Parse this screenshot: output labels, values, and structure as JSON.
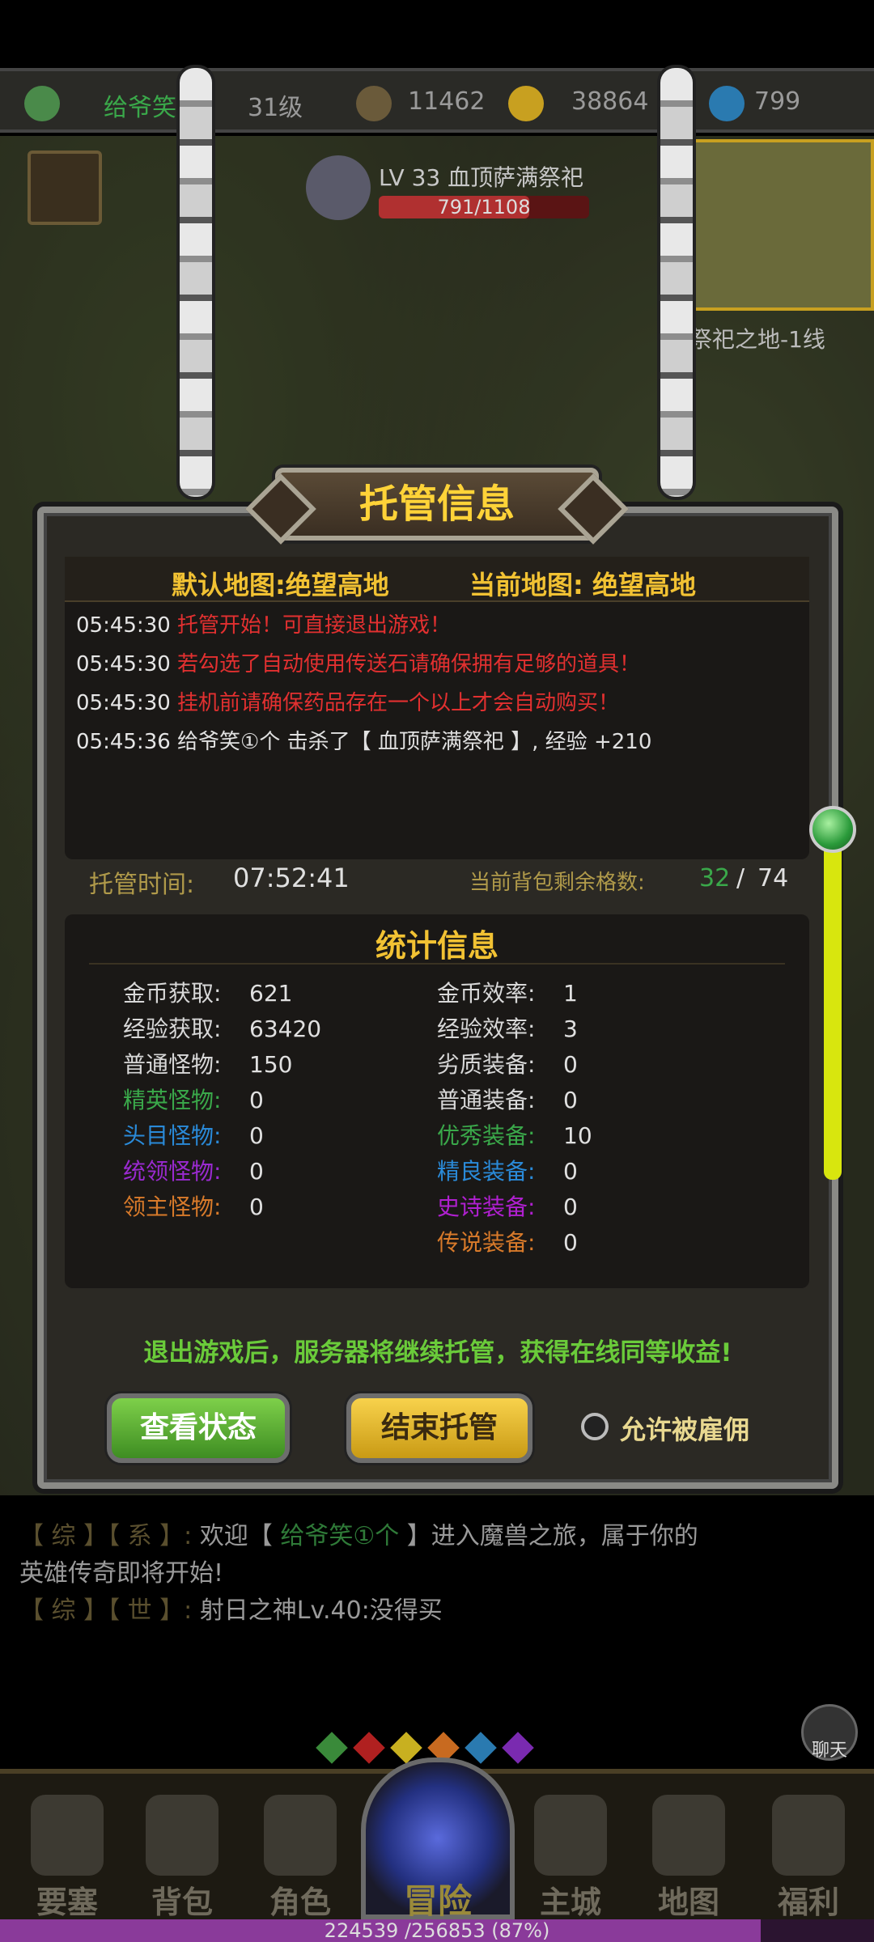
{
  "topbar": {
    "player_name": "给爷笑",
    "level": "31级",
    "gold": "11462",
    "coins": "38864",
    "diamonds": "799"
  },
  "boss": {
    "name": "LV 33 血顶萨满祭祀",
    "hp_text": "791/1108",
    "hp_fraction": 0.714
  },
  "map": {
    "name": "祭祀之地-1线"
  },
  "dialog": {
    "title": "托管信息",
    "default_map": "默认地图:绝望高地",
    "current_map": "当前地图: 绝望高地",
    "log": [
      {
        "time": "05:45:30",
        "text": "托管开始！可直接退出游戏！",
        "style": "red"
      },
      {
        "time": "05:45:30",
        "text": "若勾选了自动使用传送石请确保拥有足够的道具！",
        "style": "red"
      },
      {
        "time": "05:45:30",
        "text": "挂机前请确保药品存在一个以上才会自动购买！",
        "style": "red"
      },
      {
        "time": "05:45:36",
        "text": "给爷笑①个 击杀了【 血顶萨满祭祀 】, 经验 +210",
        "style": "normal"
      }
    ],
    "hosting_time_label": "托管时间:",
    "hosting_time": "07:52:41",
    "bag_label": "当前背包剩余格数:",
    "bag_free": "32",
    "bag_sep": "/",
    "bag_total": "74",
    "stats_title": "统计信息",
    "stats_left": [
      {
        "label": "金币获取:",
        "value": "621",
        "color": "#d8d8d8"
      },
      {
        "label": "经验获取:",
        "value": "63420",
        "color": "#d8d8d8"
      },
      {
        "label": "普通怪物:",
        "value": "150",
        "color": "#d8d8d8"
      },
      {
        "label": "精英怪物:",
        "value": "0",
        "color": "#3aa84a"
      },
      {
        "label": "头目怪物:",
        "value": "0",
        "color": "#2a8ad8"
      },
      {
        "label": "统领怪物:",
        "value": "0",
        "color": "#9a2ad0"
      },
      {
        "label": "领主怪物:",
        "value": "0",
        "color": "#d87a2a"
      }
    ],
    "stats_right": [
      {
        "label": "金币效率:",
        "value": "1",
        "color": "#d8d8d8"
      },
      {
        "label": "经验效率:",
        "value": "3",
        "color": "#d8d8d8"
      },
      {
        "label": "劣质装备:",
        "value": "0",
        "color": "#d8d8d8"
      },
      {
        "label": "普通装备:",
        "value": "0",
        "color": "#d8d8d8"
      },
      {
        "label": "优秀装备:",
        "value": "10",
        "color": "#3aa84a"
      },
      {
        "label": "精良装备:",
        "value": "0",
        "color": "#2a8ad8"
      },
      {
        "label": "史诗装备:",
        "value": "0",
        "color": "#b020d0"
      },
      {
        "label": "传说装备:",
        "value": "0",
        "color": "#d87a2a"
      }
    ],
    "notice": "退出游戏后，服务器将继续托管，获得在线同等收益!",
    "view_status_label": "查看状态",
    "end_hosting_label": "结束托管",
    "allow_hire_label": "允许被雇佣",
    "allow_hire_checked": false
  },
  "chat": {
    "line1_tag": "【 综 】【 系 】:",
    "line1_pre": "欢迎【 ",
    "line1_name": "给爷笑①个",
    "line1_post": " 】进入魔兽之旅，属于你的",
    "line1_cont": "英雄传奇即将开始!",
    "line2_tag": "【 综 】【 世 】:",
    "line2_text": "射日之神Lv.40:没得买",
    "chat_button": "聊天"
  },
  "nav": {
    "items": [
      "要塞",
      "背包",
      "角色",
      "冒险",
      "主城",
      "地图",
      "福利"
    ]
  },
  "exp": {
    "text": "224539 /256853 (87%)",
    "fraction": 0.87
  },
  "gem_colors": [
    "#3a8a3a",
    "#b02020",
    "#c8b020",
    "#c86a20",
    "#2a7ab0",
    "#7a2ab0"
  ]
}
